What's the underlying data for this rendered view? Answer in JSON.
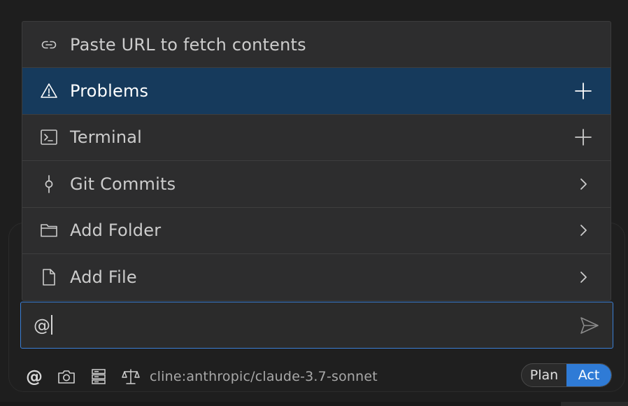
{
  "menu": {
    "items": [
      {
        "label": "Paste URL to fetch contents",
        "icon": "link-icon",
        "trailing": null,
        "selected": false
      },
      {
        "label": "Problems",
        "icon": "warning-icon",
        "trailing": "plus-icon",
        "selected": true
      },
      {
        "label": "Terminal",
        "icon": "terminal-icon",
        "trailing": "plus-icon",
        "selected": false
      },
      {
        "label": "Git Commits",
        "icon": "git-commit-icon",
        "trailing": "chevron-right-icon",
        "selected": false
      },
      {
        "label": "Add Folder",
        "icon": "folder-icon",
        "trailing": "chevron-right-icon",
        "selected": false
      },
      {
        "label": "Add File",
        "icon": "file-icon",
        "trailing": "chevron-right-icon",
        "selected": false
      }
    ]
  },
  "input": {
    "value": "@",
    "send_icon": "send-icon"
  },
  "toolbar": {
    "mention_symbol": "@",
    "icons": [
      "at-icon",
      "camera-icon",
      "server-icon",
      "scale-icon"
    ],
    "model": "cline:anthropic/claude-3.7-sonnet"
  },
  "mode": {
    "options": [
      "Plan",
      "Act"
    ],
    "active": "Act"
  },
  "colors": {
    "background": "#1e1e1e",
    "menu_bg": "#2d2d2e",
    "selected_bg": "#163a5c",
    "accent": "#3b7fd6",
    "toggle_active": "#2f7bd6"
  }
}
